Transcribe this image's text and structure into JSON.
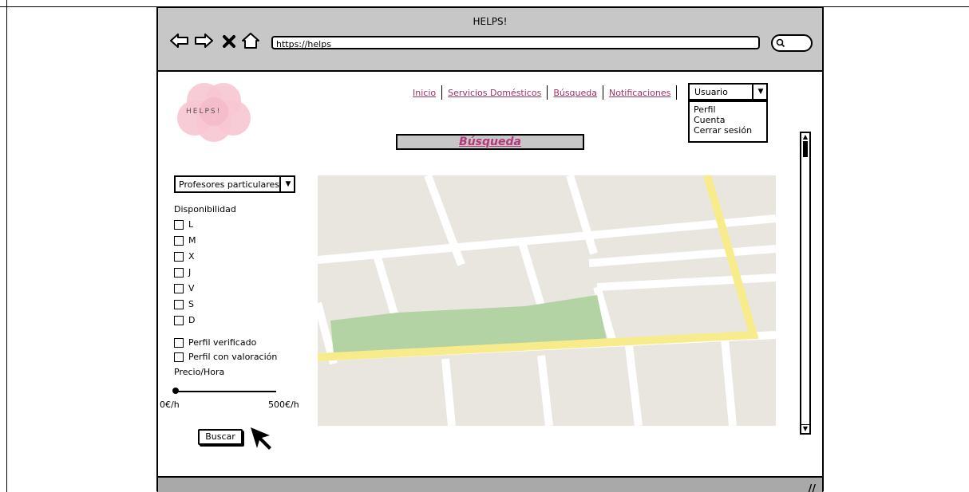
{
  "window": {
    "title": "HELPS!"
  },
  "browser": {
    "url": "https://helps"
  },
  "logo": {
    "text": "HELPS!"
  },
  "nav": {
    "links": [
      "Inicio",
      "Servicios Domésticos",
      "Búsqueda",
      "Notificaciones"
    ]
  },
  "user_menu": {
    "selected": "Usuario",
    "options": [
      "Perfil",
      "Cuenta",
      "Cerrar sesión"
    ]
  },
  "page": {
    "title": "Búsqueda"
  },
  "filters": {
    "category": "Profesores particulares",
    "availability_label": "Disponibilidad",
    "days": [
      "L",
      "M",
      "X",
      "J",
      "V",
      "S",
      "D"
    ],
    "verified_label": "Perfil verificado",
    "rated_label": "Perfil con valoración",
    "price_label": "Precio/Hora",
    "price_min": "0€/h",
    "price_max": "500€/h",
    "search_label": "Buscar"
  },
  "colors": {
    "accent": "#b4397a",
    "logo_pink": "#f7c6d3",
    "map_bg": "#e9e6e0",
    "map_road_major": "#f8eb8b",
    "map_park": "#b4d3a4"
  }
}
